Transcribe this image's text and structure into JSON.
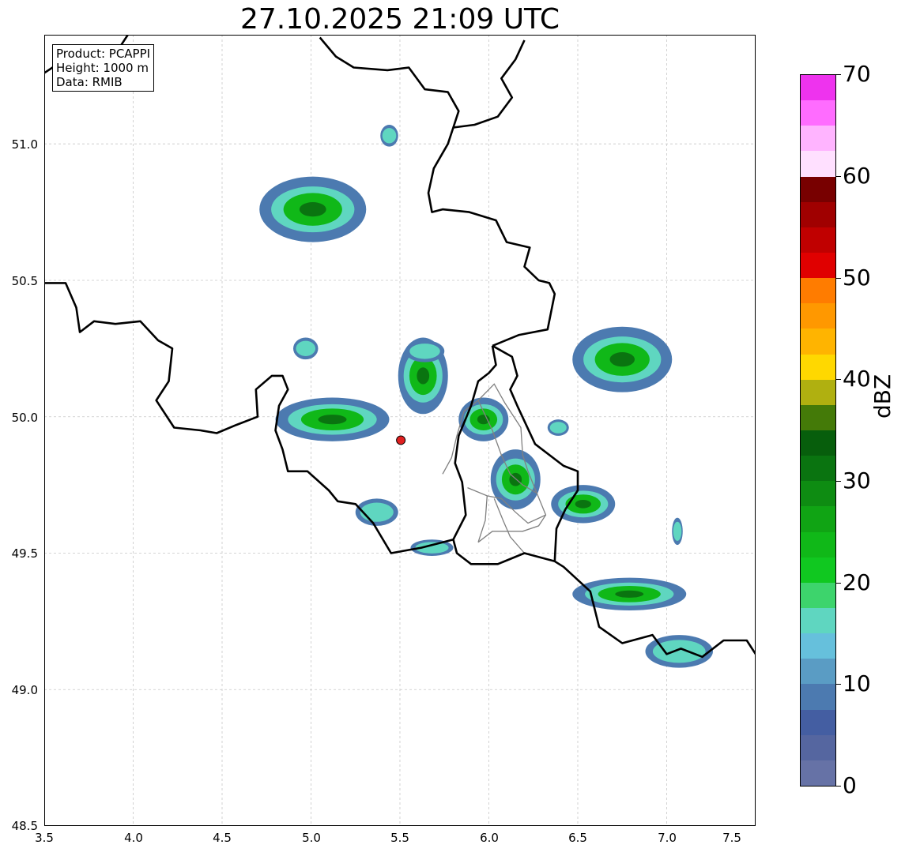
{
  "title": "27.10.2025 21:09 UTC",
  "info": {
    "product": "Product: PCAPPI",
    "height": "Height: 1000 m",
    "data": "Data: RMIB"
  },
  "axes": {
    "lon_range": [
      3.5,
      7.5
    ],
    "lat_range": [
      48.5,
      51.4
    ],
    "x_ticks": [
      "3.5",
      "4.0",
      "4.5",
      "5.0",
      "5.5",
      "6.0",
      "6.5",
      "7.0",
      "7.5"
    ],
    "y_ticks": [
      "51.0",
      "50.5",
      "50.0",
      "49.5",
      "49.0",
      "48.5"
    ],
    "grid": true
  },
  "radar_site": {
    "lon": 5.505,
    "lat": 49.914,
    "color": "#e02020"
  },
  "colorbar": {
    "label": "dBZ",
    "range": [
      0,
      70
    ],
    "ticks": [
      "0",
      "10",
      "20",
      "30",
      "40",
      "50",
      "60",
      "70"
    ],
    "colors": [
      "#6672a6",
      "#5566a0",
      "#445ea2",
      "#4c7ab0",
      "#5a9cc4",
      "#66c0dc",
      "#5fd6c0",
      "#3dd46c",
      "#10c820",
      "#10b818",
      "#10a414",
      "#0e8c12",
      "#0a7410",
      "#075e0c",
      "#447a08",
      "#b0b010",
      "#ffd800",
      "#ffb400",
      "#ff9800",
      "#ff7c00",
      "#e00000",
      "#c00000",
      "#a00000",
      "#780000",
      "#ffe0ff",
      "#ffb4ff",
      "#ff6cff",
      "#ee33ee"
    ]
  },
  "precip_cells": [
    {
      "lon": 5.01,
      "lat": 50.76,
      "rx": 0.3,
      "ry": 0.12,
      "level": "moderate"
    },
    {
      "lon": 5.44,
      "lat": 51.03,
      "rx": 0.05,
      "ry": 0.04,
      "level": "light"
    },
    {
      "lon": 5.12,
      "lat": 49.99,
      "rx": 0.32,
      "ry": 0.08,
      "level": "moderate"
    },
    {
      "lon": 5.63,
      "lat": 50.15,
      "rx": 0.14,
      "ry": 0.14,
      "level": "moderate"
    },
    {
      "lon": 5.64,
      "lat": 50.24,
      "rx": 0.11,
      "ry": 0.04,
      "level": "light"
    },
    {
      "lon": 4.97,
      "lat": 50.25,
      "rx": 0.07,
      "ry": 0.04,
      "level": "light"
    },
    {
      "lon": 5.97,
      "lat": 49.99,
      "rx": 0.14,
      "ry": 0.08,
      "level": "moderate"
    },
    {
      "lon": 6.15,
      "lat": 49.77,
      "rx": 0.14,
      "ry": 0.11,
      "level": "moderate"
    },
    {
      "lon": 6.53,
      "lat": 49.68,
      "rx": 0.18,
      "ry": 0.07,
      "level": "moderate"
    },
    {
      "lon": 6.39,
      "lat": 49.96,
      "rx": 0.06,
      "ry": 0.03,
      "level": "light"
    },
    {
      "lon": 6.75,
      "lat": 50.21,
      "rx": 0.28,
      "ry": 0.12,
      "level": "moderate"
    },
    {
      "lon": 6.79,
      "lat": 49.35,
      "rx": 0.32,
      "ry": 0.06,
      "level": "moderate"
    },
    {
      "lon": 7.07,
      "lat": 49.14,
      "rx": 0.19,
      "ry": 0.06,
      "level": "light"
    },
    {
      "lon": 5.37,
      "lat": 49.65,
      "rx": 0.12,
      "ry": 0.05,
      "level": "light"
    },
    {
      "lon": 5.68,
      "lat": 49.52,
      "rx": 0.12,
      "ry": 0.03,
      "level": "light"
    },
    {
      "lon": 7.06,
      "lat": 49.58,
      "rx": 0.03,
      "ry": 0.05,
      "level": "light"
    }
  ],
  "borders": {
    "national": [
      [
        [
          3.5,
          50.49
        ],
        [
          3.62,
          50.49
        ],
        [
          3.68,
          50.4
        ],
        [
          3.7,
          50.31
        ],
        [
          3.78,
          50.35
        ],
        [
          3.9,
          50.34
        ],
        [
          4.04,
          50.35
        ],
        [
          4.14,
          50.28
        ],
        [
          4.22,
          50.25
        ],
        [
          4.2,
          50.13
        ],
        [
          4.13,
          50.06
        ],
        [
          4.23,
          49.96
        ],
        [
          4.38,
          49.95
        ],
        [
          4.47,
          49.94
        ],
        [
          4.58,
          49.97
        ],
        [
          4.7,
          50.0
        ],
        [
          4.69,
          50.1
        ],
        [
          4.78,
          50.15
        ],
        [
          4.84,
          50.15
        ],
        [
          4.87,
          50.1
        ],
        [
          4.82,
          50.04
        ],
        [
          4.8,
          49.95
        ],
        [
          4.84,
          49.88
        ],
        [
          4.87,
          49.8
        ],
        [
          4.98,
          49.8
        ],
        [
          5.1,
          49.73
        ],
        [
          5.15,
          49.69
        ],
        [
          5.25,
          49.68
        ],
        [
          5.35,
          49.61
        ],
        [
          5.45,
          49.5
        ],
        [
          5.62,
          49.52
        ],
        [
          5.74,
          49.54
        ],
        [
          5.8,
          49.55
        ],
        [
          5.82,
          49.5
        ],
        [
          5.9,
          49.46
        ],
        [
          6.05,
          49.46
        ],
        [
          6.2,
          49.5
        ],
        [
          6.37,
          49.47
        ],
        [
          6.42,
          49.45
        ],
        [
          6.57,
          49.36
        ],
        [
          6.62,
          49.23
        ],
        [
          6.75,
          49.17
        ],
        [
          6.92,
          49.2
        ],
        [
          7.0,
          49.13
        ],
        [
          7.08,
          49.15
        ],
        [
          7.2,
          49.12
        ],
        [
          7.32,
          49.18
        ],
        [
          7.45,
          49.18
        ],
        [
          7.5,
          49.13
        ]
      ],
      [
        [
          6.02,
          50.26
        ],
        [
          6.04,
          50.19
        ],
        [
          6.0,
          50.16
        ],
        [
          5.94,
          50.13
        ],
        [
          5.9,
          50.04
        ],
        [
          5.83,
          49.93
        ],
        [
          5.81,
          49.83
        ],
        [
          5.85,
          49.76
        ],
        [
          5.87,
          49.64
        ],
        [
          5.8,
          49.55
        ]
      ],
      [
        [
          6.02,
          50.26
        ],
        [
          6.13,
          50.22
        ],
        [
          6.16,
          50.15
        ],
        [
          6.12,
          50.1
        ],
        [
          6.16,
          50.04
        ],
        [
          6.26,
          49.9
        ],
        [
          6.42,
          49.82
        ],
        [
          6.5,
          49.8
        ],
        [
          6.5,
          49.73
        ],
        [
          6.43,
          49.66
        ],
        [
          6.38,
          49.59
        ],
        [
          6.37,
          49.47
        ]
      ],
      [
        [
          6.02,
          50.26
        ],
        [
          6.17,
          50.3
        ],
        [
          6.33,
          50.32
        ],
        [
          6.37,
          50.45
        ],
        [
          6.34,
          50.49
        ],
        [
          6.28,
          50.5
        ],
        [
          6.2,
          50.55
        ],
        [
          6.23,
          50.62
        ],
        [
          6.1,
          50.64
        ],
        [
          6.04,
          50.72
        ],
        [
          5.89,
          50.75
        ],
        [
          5.74,
          50.76
        ],
        [
          5.68,
          50.75
        ],
        [
          5.66,
          50.82
        ],
        [
          5.69,
          50.91
        ],
        [
          5.77,
          51.0
        ],
        [
          5.8,
          51.06
        ],
        [
          5.83,
          51.12
        ],
        [
          5.77,
          51.19
        ],
        [
          5.64,
          51.2
        ],
        [
          5.55,
          51.28
        ],
        [
          5.43,
          51.27
        ],
        [
          5.24,
          51.28
        ],
        [
          5.14,
          51.32
        ],
        [
          5.05,
          51.39
        ]
      ],
      [
        [
          5.8,
          51.06
        ],
        [
          5.92,
          51.07
        ],
        [
          6.05,
          51.1
        ],
        [
          6.13,
          51.17
        ],
        [
          6.07,
          51.24
        ],
        [
          6.15,
          51.31
        ],
        [
          6.2,
          51.38
        ]
      ],
      [
        [
          3.5,
          51.26
        ],
        [
          3.57,
          51.29
        ],
        [
          3.71,
          51.31
        ],
        [
          3.83,
          51.28
        ],
        [
          3.93,
          51.36
        ],
        [
          3.97,
          51.4
        ]
      ]
    ],
    "regional": [
      [
        [
          5.74,
          49.79
        ],
        [
          5.79,
          49.85
        ],
        [
          5.82,
          49.93
        ],
        [
          5.86,
          50.02
        ],
        [
          5.94,
          50.06
        ],
        [
          6.03,
          50.12
        ],
        [
          6.09,
          50.05
        ],
        [
          6.18,
          49.96
        ],
        [
          6.19,
          49.86
        ],
        [
          6.22,
          49.8
        ],
        [
          6.27,
          49.72
        ],
        [
          6.32,
          49.64
        ],
        [
          6.28,
          49.6
        ],
        [
          6.19,
          49.58
        ],
        [
          6.1,
          49.58
        ],
        [
          6.02,
          49.58
        ],
        [
          5.94,
          49.54
        ]
      ],
      [
        [
          5.94,
          50.06
        ],
        [
          6.02,
          49.95
        ],
        [
          6.07,
          49.86
        ],
        [
          6.12,
          49.79
        ],
        [
          6.19,
          49.75
        ],
        [
          6.27,
          49.72
        ]
      ],
      [
        [
          5.88,
          49.74
        ],
        [
          5.99,
          49.71
        ],
        [
          6.07,
          49.7
        ],
        [
          6.15,
          49.65
        ],
        [
          6.22,
          49.61
        ],
        [
          6.32,
          49.64
        ]
      ],
      [
        [
          6.03,
          49.7
        ],
        [
          6.08,
          49.62
        ],
        [
          6.12,
          49.56
        ],
        [
          6.2,
          49.5
        ]
      ],
      [
        [
          5.99,
          49.71
        ],
        [
          5.98,
          49.62
        ],
        [
          5.94,
          49.54
        ]
      ]
    ]
  }
}
